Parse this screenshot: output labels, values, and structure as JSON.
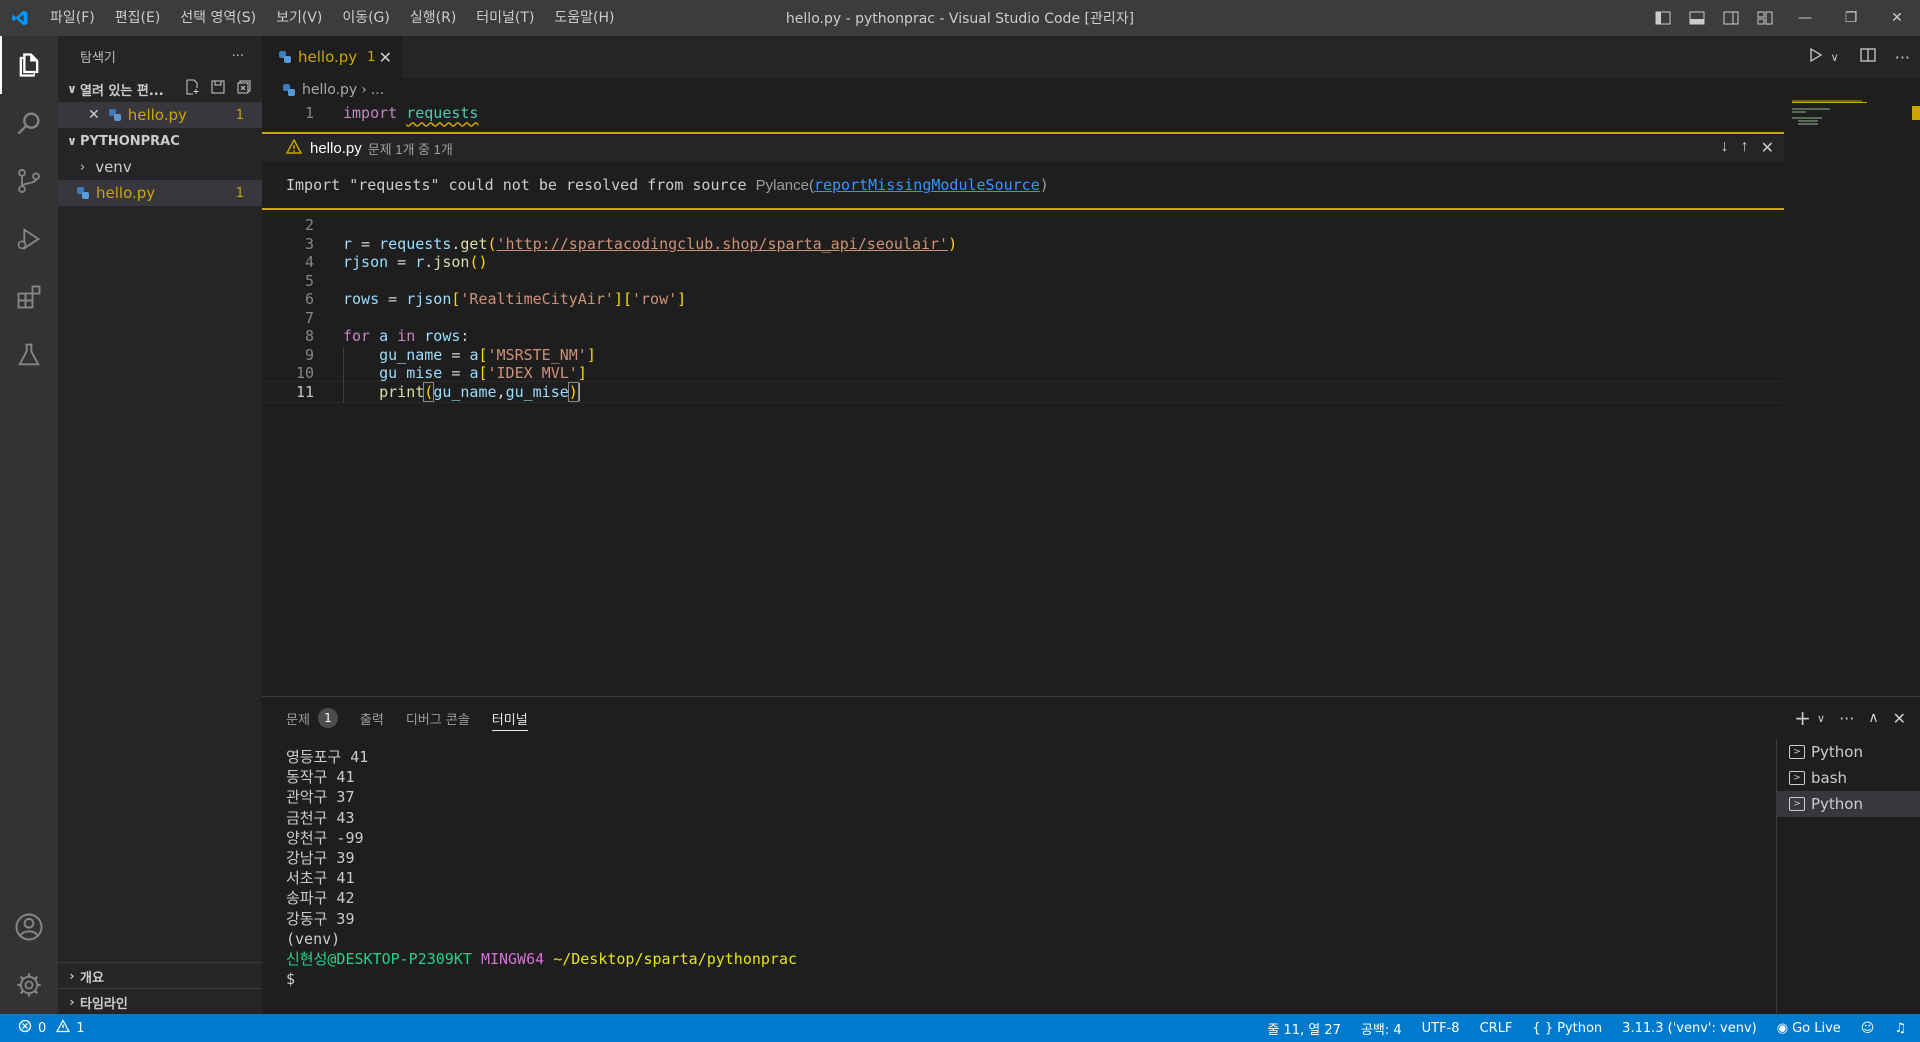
{
  "titlebar": {
    "menu": [
      "파일(F)",
      "편집(E)",
      "선택 영역(S)",
      "보기(V)",
      "이동(G)",
      "실행(R)",
      "터미널(T)",
      "도움말(H)"
    ],
    "title": "hello.py - pythonprac - Visual Studio Code [관리자]"
  },
  "sidebar": {
    "header": "탐색기",
    "open_editors": "열려 있는 편...",
    "open_file": "hello.py",
    "open_file_count": "1",
    "project": "PYTHONPRAC",
    "folder": "venv",
    "file": "hello.py",
    "file_count": "1",
    "outline": "개요",
    "timeline": "타임라인"
  },
  "editor": {
    "tab_label": "hello.py",
    "tab_count": "1",
    "breadcrumb_file": "hello.py",
    "breadcrumb_more": "...",
    "peek": {
      "file": "hello.py",
      "count": "문제 1개 중 1개",
      "message": "Import \"requests\" could not be resolved from source",
      "source": "Pylance(",
      "rule": "reportMissingModuleSource",
      "close_paren": ")"
    },
    "lines": [
      "1",
      "2",
      "3",
      "4",
      "5",
      "6",
      "7",
      "8",
      "9",
      "10",
      "11"
    ]
  },
  "panel": {
    "tabs": {
      "problems": "문제",
      "problems_count": "1",
      "output": "출력",
      "debug": "디버그 콘솔",
      "terminal": "터미널"
    },
    "terminal_lines": [
      "영등포구 41",
      "동작구 41",
      "관악구 37",
      "금천구 43",
      "양천구 -99",
      "강남구 39",
      "서초구 41",
      "송파구 42",
      "강동구 39",
      "(venv)"
    ],
    "prompt_user": "신현성@DESKTOP-P2309KT",
    "prompt_shell": "MINGW64",
    "prompt_path": "~/Desktop/sparta/pythonprac",
    "prompt_symbol": "$",
    "terminals": [
      "Python",
      "bash",
      "Python"
    ]
  },
  "statusbar": {
    "errors": "0",
    "warnings": "1",
    "position": "줄 11, 열 27",
    "spaces": "공백: 4",
    "encoding": "UTF-8",
    "eol": "CRLF",
    "language": "Python",
    "interpreter": "3.11.3 ('venv': venv)",
    "golive": "Go Live"
  },
  "colors": {
    "accent": "#007acc",
    "warning": "#cca700",
    "titlebar": "#3c3c3c"
  }
}
